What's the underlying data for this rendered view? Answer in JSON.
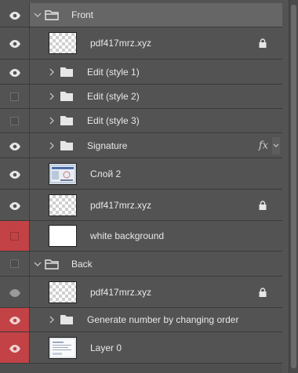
{
  "layers": [
    {
      "id": "front",
      "label": "Front"
    },
    {
      "id": "pdf1",
      "label": "pdf417mrz.xyz"
    },
    {
      "id": "edit1",
      "label": "Edit (style 1)"
    },
    {
      "id": "edit2",
      "label": "Edit (style 2)"
    },
    {
      "id": "edit3",
      "label": "Edit (style 3)"
    },
    {
      "id": "signature",
      "label": "Signature",
      "fx": "fx"
    },
    {
      "id": "sloy2",
      "label": "Слой 2"
    },
    {
      "id": "pdf2",
      "label": "pdf417mrz.xyz"
    },
    {
      "id": "whitebg",
      "label": "white background"
    },
    {
      "id": "back",
      "label": "Back"
    },
    {
      "id": "pdf3",
      "label": "pdf417mrz.xyz"
    },
    {
      "id": "gen",
      "label": "Generate number by changing order"
    },
    {
      "id": "layer0",
      "label": "Layer 0"
    }
  ]
}
